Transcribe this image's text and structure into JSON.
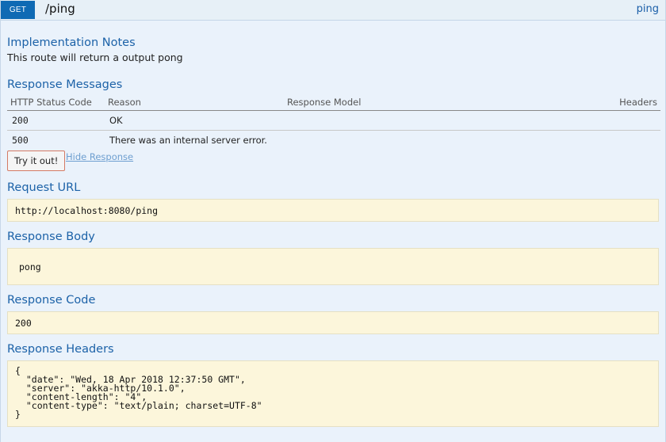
{
  "operation": {
    "method": "GET",
    "path": "/ping",
    "link": "ping"
  },
  "implementation_notes": {
    "title": "Implementation Notes",
    "text": "This route will return a output pong"
  },
  "response_messages": {
    "title": "Response Messages",
    "columns": {
      "status": "HTTP Status Code",
      "reason": "Reason",
      "model": "Response Model",
      "headers": "Headers"
    },
    "rows": [
      {
        "code": "200",
        "reason": "OK",
        "model": "",
        "headers": ""
      },
      {
        "code": "500",
        "reason": "There was an internal server error.",
        "model": "",
        "headers": ""
      }
    ]
  },
  "actions": {
    "try_label": "Try it out!",
    "hide_label": "Hide Response"
  },
  "request_url": {
    "title": "Request URL",
    "value": "http://localhost:8080/ping"
  },
  "response_body": {
    "title": "Response Body",
    "value": "pong"
  },
  "response_code": {
    "title": "Response Code",
    "value": "200"
  },
  "response_headers": {
    "title": "Response Headers",
    "value": "{\n  \"date\": \"Wed, 18 Apr 2018 12:37:50 GMT\",\n  \"server\": \"akka-http/10.1.0\",\n  \"content-length\": \"4\",\n  \"content-type\": \"text/plain; charset=UTF-8\"\n}"
  }
}
